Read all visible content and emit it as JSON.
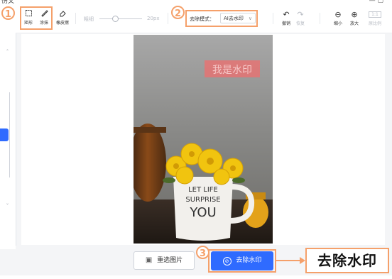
{
  "app": {
    "title_partial": "伤叉"
  },
  "toolbar": {
    "rect_label": "矩形",
    "brush_label": "涂抹",
    "eraser_label": "橡皮擦",
    "size_label": "粗细",
    "size_value": "20px",
    "mode_label": "去除模式：",
    "mode_value": "AI去水印",
    "undo_label": "撤销",
    "redo_label": "恢复",
    "zoom_out_label": "缩小",
    "zoom_in_label": "放大",
    "ratio_button": "1:1",
    "ratio_label": "原比例"
  },
  "steps": {
    "one": "1",
    "two": "2",
    "three": "3"
  },
  "image": {
    "watermark_text": "我是水印",
    "mug_lines": [
      "LET LIFE",
      "SURPRISE",
      "YOU"
    ]
  },
  "bottom": {
    "reselect_label": "重选图片",
    "remove_label": "去除水印",
    "callout_text": "去除水印"
  },
  "colors": {
    "accent_blue": "#2f6bff",
    "highlight_orange": "#f5a06a",
    "watermark_red": "#e57373"
  },
  "icons": {
    "rect": "rectangle-select-icon",
    "brush": "brush-icon",
    "eraser": "eraser-icon",
    "undo": "undo-icon",
    "redo": "redo-icon",
    "zoom_out": "zoom-out-icon",
    "zoom_in": "zoom-in-icon",
    "image": "image-icon",
    "remove": "remove-watermark-icon"
  }
}
